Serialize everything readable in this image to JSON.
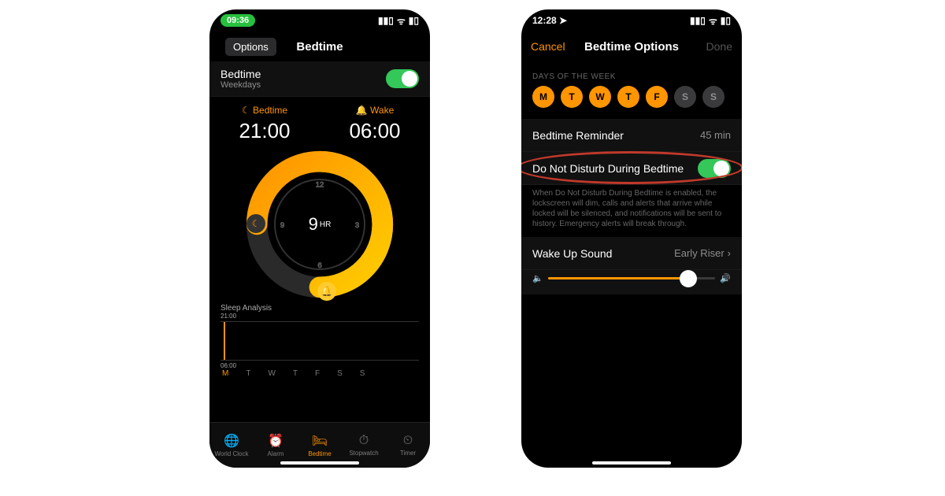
{
  "left": {
    "status": {
      "time": "09:36"
    },
    "nav": {
      "options": "Options",
      "title": "Bedtime"
    },
    "enable": {
      "title": "Bedtime",
      "sub": "Weekdays"
    },
    "times": {
      "bed_label": "Bedtime",
      "bed": "21:00",
      "wake_label": "Wake",
      "wake": "06:00"
    },
    "dial": {
      "hours": "9",
      "unit": "HR"
    },
    "analysis": {
      "title": "Sleep Analysis",
      "top": "21:00",
      "bottom": "06:00",
      "days": [
        "M",
        "T",
        "W",
        "T",
        "F",
        "S",
        "S"
      ]
    },
    "tabs": {
      "world": "World Clock",
      "alarm": "Alarm",
      "bedtime": "Bedtime",
      "stopwatch": "Stopwatch",
      "timer": "Timer"
    }
  },
  "right": {
    "status": {
      "time": "12:28"
    },
    "nav": {
      "cancel": "Cancel",
      "title": "Bedtime Options",
      "done": "Done"
    },
    "days_header": "DAYS OF THE WEEK",
    "days": [
      "M",
      "T",
      "W",
      "T",
      "F",
      "S",
      "S"
    ],
    "reminder": {
      "label": "Bedtime Reminder",
      "value": "45 min"
    },
    "dnd": {
      "label": "Do Not Disturb During Bedtime"
    },
    "dnd_desc": "When Do Not Disturb During Bedtime is enabled, the lockscreen will dim, calls and alerts that arrive while locked will be silenced, and notifications will be sent to history. Emergency alerts will break through.",
    "wake_sound": {
      "label": "Wake Up Sound",
      "value": "Early Riser"
    }
  }
}
